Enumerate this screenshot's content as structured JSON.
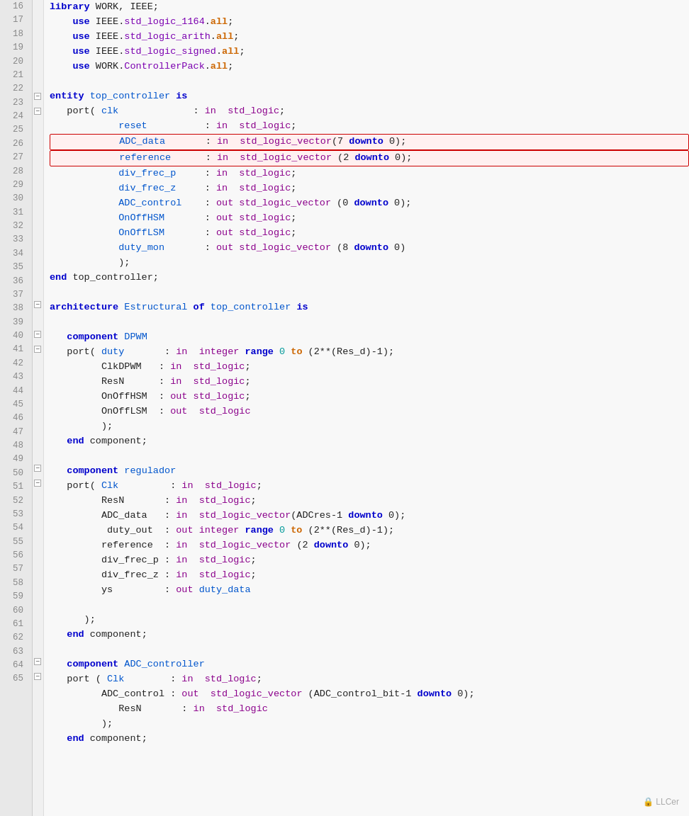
{
  "lines": [
    {
      "num": 16,
      "fold": null,
      "tokens": [
        {
          "t": "library ",
          "c": "kw-blue"
        },
        {
          "t": "WORK, IEEE;",
          "c": "normal"
        }
      ]
    },
    {
      "num": 17,
      "fold": null,
      "tokens": [
        {
          "t": "    use ",
          "c": "kw-blue"
        },
        {
          "t": "IEEE.",
          "c": "normal"
        },
        {
          "t": "std_logic_1164",
          "c": "id-violet"
        },
        {
          "t": ".",
          "c": "normal"
        },
        {
          "t": "all",
          "c": "kw-orange"
        },
        {
          "t": ";",
          "c": "normal"
        }
      ]
    },
    {
      "num": 18,
      "fold": null,
      "tokens": [
        {
          "t": "    use ",
          "c": "kw-blue"
        },
        {
          "t": "IEEE.",
          "c": "normal"
        },
        {
          "t": "std_logic_arith",
          "c": "id-violet"
        },
        {
          "t": ".",
          "c": "normal"
        },
        {
          "t": "all",
          "c": "kw-orange"
        },
        {
          "t": ";",
          "c": "normal"
        }
      ]
    },
    {
      "num": 19,
      "fold": null,
      "tokens": [
        {
          "t": "    use ",
          "c": "kw-blue"
        },
        {
          "t": "IEEE.",
          "c": "normal"
        },
        {
          "t": "std_logic_signed",
          "c": "id-violet"
        },
        {
          "t": ".",
          "c": "normal"
        },
        {
          "t": "all",
          "c": "kw-orange"
        },
        {
          "t": ";",
          "c": "normal"
        }
      ]
    },
    {
      "num": 20,
      "fold": null,
      "tokens": [
        {
          "t": "    use ",
          "c": "kw-blue"
        },
        {
          "t": "WORK.",
          "c": "normal"
        },
        {
          "t": "ControllerPack",
          "c": "id-violet"
        },
        {
          "t": ".",
          "c": "normal"
        },
        {
          "t": "all",
          "c": "kw-orange"
        },
        {
          "t": ";",
          "c": "normal"
        }
      ]
    },
    {
      "num": 21,
      "fold": null,
      "tokens": []
    },
    {
      "num": 22,
      "fold": "minus",
      "tokens": [
        {
          "t": "entity ",
          "c": "kw-blue"
        },
        {
          "t": "top_controller ",
          "c": "id-blue2"
        },
        {
          "t": "is",
          "c": "kw-blue"
        }
      ]
    },
    {
      "num": 23,
      "fold": "minus",
      "tokens": [
        {
          "t": "   port( ",
          "c": "normal"
        },
        {
          "t": "clk",
          "c": "id-blue2"
        },
        {
          "t": "             : ",
          "c": "normal"
        },
        {
          "t": "in  ",
          "c": "kw-purple"
        },
        {
          "t": "std_logic",
          "c": "kw-purple"
        },
        {
          "t": ";",
          "c": "normal"
        }
      ]
    },
    {
      "num": 24,
      "fold": null,
      "tokens": [
        {
          "t": "            ",
          "c": "normal"
        },
        {
          "t": "reset",
          "c": "id-blue2"
        },
        {
          "t": "          : ",
          "c": "normal"
        },
        {
          "t": "in  ",
          "c": "kw-purple"
        },
        {
          "t": "std_logic",
          "c": "kw-purple"
        },
        {
          "t": ";",
          "c": "normal"
        }
      ]
    },
    {
      "num": 25,
      "fold": null,
      "highlight": true,
      "tokens": [
        {
          "t": "            ",
          "c": "normal"
        },
        {
          "t": "ADC_data",
          "c": "id-blue2"
        },
        {
          "t": "       : ",
          "c": "normal"
        },
        {
          "t": "in  ",
          "c": "kw-purple"
        },
        {
          "t": "std_logic_vector",
          "c": "kw-purple"
        },
        {
          "t": "(7 ",
          "c": "normal"
        },
        {
          "t": "downto",
          "c": "kw-blue"
        },
        {
          "t": " 0);",
          "c": "normal"
        }
      ]
    },
    {
      "num": 26,
      "fold": null,
      "highlight": true,
      "tokens": [
        {
          "t": "            ",
          "c": "normal"
        },
        {
          "t": "reference",
          "c": "id-blue2"
        },
        {
          "t": "      : ",
          "c": "normal"
        },
        {
          "t": "in  ",
          "c": "kw-purple"
        },
        {
          "t": "std_logic_vector ",
          "c": "kw-purple"
        },
        {
          "t": "(2 ",
          "c": "normal"
        },
        {
          "t": "downto",
          "c": "kw-blue"
        },
        {
          "t": " 0);",
          "c": "normal"
        }
      ]
    },
    {
      "num": 27,
      "fold": null,
      "tokens": [
        {
          "t": "            ",
          "c": "normal"
        },
        {
          "t": "div_frec_p",
          "c": "id-blue2"
        },
        {
          "t": "     : ",
          "c": "normal"
        },
        {
          "t": "in  ",
          "c": "kw-purple"
        },
        {
          "t": "std_logic",
          "c": "kw-purple"
        },
        {
          "t": ";",
          "c": "normal"
        }
      ]
    },
    {
      "num": 28,
      "fold": null,
      "tokens": [
        {
          "t": "            ",
          "c": "normal"
        },
        {
          "t": "div_frec_z",
          "c": "id-blue2"
        },
        {
          "t": "     : ",
          "c": "normal"
        },
        {
          "t": "in  ",
          "c": "kw-purple"
        },
        {
          "t": "std_logic",
          "c": "kw-purple"
        },
        {
          "t": ";",
          "c": "normal"
        }
      ]
    },
    {
      "num": 29,
      "fold": null,
      "tokens": [
        {
          "t": "            ",
          "c": "normal"
        },
        {
          "t": "ADC_control",
          "c": "id-blue2"
        },
        {
          "t": "    : ",
          "c": "normal"
        },
        {
          "t": "out ",
          "c": "kw-purple"
        },
        {
          "t": "std_logic_vector ",
          "c": "kw-purple"
        },
        {
          "t": "(0 ",
          "c": "normal"
        },
        {
          "t": "downto",
          "c": "kw-blue"
        },
        {
          "t": " 0);",
          "c": "normal"
        }
      ]
    },
    {
      "num": 30,
      "fold": null,
      "tokens": [
        {
          "t": "            ",
          "c": "normal"
        },
        {
          "t": "OnOffHSM",
          "c": "id-blue2"
        },
        {
          "t": "       : ",
          "c": "normal"
        },
        {
          "t": "out ",
          "c": "kw-purple"
        },
        {
          "t": "std_logic",
          "c": "kw-purple"
        },
        {
          "t": ";",
          "c": "normal"
        }
      ]
    },
    {
      "num": 31,
      "fold": null,
      "tokens": [
        {
          "t": "            ",
          "c": "normal"
        },
        {
          "t": "OnOffLSM",
          "c": "id-blue2"
        },
        {
          "t": "       : ",
          "c": "normal"
        },
        {
          "t": "out ",
          "c": "kw-purple"
        },
        {
          "t": "std_logic",
          "c": "kw-purple"
        },
        {
          "t": ";",
          "c": "normal"
        }
      ]
    },
    {
      "num": 32,
      "fold": null,
      "tokens": [
        {
          "t": "            ",
          "c": "normal"
        },
        {
          "t": "duty_mon",
          "c": "id-blue2"
        },
        {
          "t": "       : ",
          "c": "normal"
        },
        {
          "t": "out ",
          "c": "kw-purple"
        },
        {
          "t": "std_logic_vector ",
          "c": "kw-purple"
        },
        {
          "t": "(8 ",
          "c": "normal"
        },
        {
          "t": "downto",
          "c": "kw-blue"
        },
        {
          "t": " 0)",
          "c": "normal"
        }
      ]
    },
    {
      "num": 33,
      "fold": null,
      "tokens": [
        {
          "t": "            ",
          "c": "normal"
        },
        {
          "t": ");",
          "c": "normal"
        }
      ]
    },
    {
      "num": 34,
      "fold": null,
      "tokens": [
        {
          "t": "end ",
          "c": "kw-blue"
        },
        {
          "t": "top_controller;",
          "c": "normal"
        }
      ]
    },
    {
      "num": 35,
      "fold": null,
      "tokens": []
    },
    {
      "num": 36,
      "fold": "minus",
      "tokens": [
        {
          "t": "architecture ",
          "c": "kw-blue"
        },
        {
          "t": "Estructural ",
          "c": "id-blue2"
        },
        {
          "t": "of ",
          "c": "kw-blue"
        },
        {
          "t": "top_controller ",
          "c": "id-blue2"
        },
        {
          "t": "is",
          "c": "kw-blue"
        }
      ]
    },
    {
      "num": 37,
      "fold": null,
      "tokens": []
    },
    {
      "num": 38,
      "fold": "minus",
      "tokens": [
        {
          "t": "   component ",
          "c": "kw-blue"
        },
        {
          "t": "DPWM",
          "c": "id-blue2"
        }
      ]
    },
    {
      "num": 39,
      "fold": "minus",
      "tokens": [
        {
          "t": "   port( ",
          "c": "normal"
        },
        {
          "t": "duty",
          "c": "id-blue2"
        },
        {
          "t": "       : ",
          "c": "normal"
        },
        {
          "t": "in  ",
          "c": "kw-purple"
        },
        {
          "t": "integer ",
          "c": "kw-purple"
        },
        {
          "t": "range ",
          "c": "kw-blue"
        },
        {
          "t": "0 ",
          "c": "num"
        },
        {
          "t": "to",
          "c": "kw-orange"
        },
        {
          "t": " (2**(Res_d)-1);",
          "c": "normal"
        }
      ]
    },
    {
      "num": 40,
      "fold": null,
      "tokens": [
        {
          "t": "         ClkDPWM   : ",
          "c": "normal"
        },
        {
          "t": "in  ",
          "c": "kw-purple"
        },
        {
          "t": "std_logic",
          "c": "kw-purple"
        },
        {
          "t": ";",
          "c": "normal"
        }
      ]
    },
    {
      "num": 41,
      "fold": null,
      "tokens": [
        {
          "t": "         ResN      : ",
          "c": "normal"
        },
        {
          "t": "in  ",
          "c": "kw-purple"
        },
        {
          "t": "std_logic",
          "c": "kw-purple"
        },
        {
          "t": ";",
          "c": "normal"
        }
      ]
    },
    {
      "num": 42,
      "fold": null,
      "tokens": [
        {
          "t": "         OnOffHSM  : ",
          "c": "normal"
        },
        {
          "t": "out ",
          "c": "kw-purple"
        },
        {
          "t": "std_logic",
          "c": "kw-purple"
        },
        {
          "t": ";",
          "c": "normal"
        }
      ]
    },
    {
      "num": 43,
      "fold": null,
      "tokens": [
        {
          "t": "         OnOffLSM  : ",
          "c": "normal"
        },
        {
          "t": "out  ",
          "c": "kw-purple"
        },
        {
          "t": "std_logic",
          "c": "kw-purple"
        }
      ]
    },
    {
      "num": 44,
      "fold": null,
      "tokens": [
        {
          "t": "         );",
          "c": "normal"
        }
      ]
    },
    {
      "num": 45,
      "fold": null,
      "tokens": [
        {
          "t": "   end ",
          "c": "kw-blue"
        },
        {
          "t": "component;",
          "c": "normal"
        }
      ]
    },
    {
      "num": 46,
      "fold": null,
      "tokens": []
    },
    {
      "num": 47,
      "fold": "minus",
      "tokens": [
        {
          "t": "   component ",
          "c": "kw-blue"
        },
        {
          "t": "regulador",
          "c": "id-blue2"
        }
      ]
    },
    {
      "num": 48,
      "fold": "minus",
      "tokens": [
        {
          "t": "   port( ",
          "c": "normal"
        },
        {
          "t": "Clk",
          "c": "id-blue2"
        },
        {
          "t": "         : ",
          "c": "normal"
        },
        {
          "t": "in  ",
          "c": "kw-purple"
        },
        {
          "t": "std_logic",
          "c": "kw-purple"
        },
        {
          "t": ";",
          "c": "normal"
        }
      ]
    },
    {
      "num": 49,
      "fold": null,
      "tokens": [
        {
          "t": "         ResN       : ",
          "c": "normal"
        },
        {
          "t": "in  ",
          "c": "kw-purple"
        },
        {
          "t": "std_logic",
          "c": "kw-purple"
        },
        {
          "t": ";",
          "c": "normal"
        }
      ]
    },
    {
      "num": 50,
      "fold": null,
      "tokens": [
        {
          "t": "         ADC_data   : ",
          "c": "normal"
        },
        {
          "t": "in  ",
          "c": "kw-purple"
        },
        {
          "t": "std_logic_vector",
          "c": "kw-purple"
        },
        {
          "t": "(ADCres-1 ",
          "c": "normal"
        },
        {
          "t": "downto",
          "c": "kw-blue"
        },
        {
          "t": " 0);",
          "c": "normal"
        }
      ]
    },
    {
      "num": 51,
      "fold": null,
      "tokens": [
        {
          "t": "          duty_out  : ",
          "c": "normal"
        },
        {
          "t": "out ",
          "c": "kw-purple"
        },
        {
          "t": "integer ",
          "c": "kw-purple"
        },
        {
          "t": "range ",
          "c": "kw-blue"
        },
        {
          "t": "0 ",
          "c": "num"
        },
        {
          "t": "to",
          "c": "kw-orange"
        },
        {
          "t": " (2**(Res_d)-1);",
          "c": "normal"
        }
      ]
    },
    {
      "num": 52,
      "fold": null,
      "tokens": [
        {
          "t": "         reference  : ",
          "c": "normal"
        },
        {
          "t": "in  ",
          "c": "kw-purple"
        },
        {
          "t": "std_logic_vector ",
          "c": "kw-purple"
        },
        {
          "t": "(2 ",
          "c": "normal"
        },
        {
          "t": "downto",
          "c": "kw-blue"
        },
        {
          "t": " 0);",
          "c": "normal"
        }
      ]
    },
    {
      "num": 53,
      "fold": null,
      "tokens": [
        {
          "t": "         div_frec_p : ",
          "c": "normal"
        },
        {
          "t": "in  ",
          "c": "kw-purple"
        },
        {
          "t": "std_logic",
          "c": "kw-purple"
        },
        {
          "t": ";",
          "c": "normal"
        }
      ]
    },
    {
      "num": 54,
      "fold": null,
      "tokens": [
        {
          "t": "         div_frec_z : ",
          "c": "normal"
        },
        {
          "t": "in  ",
          "c": "kw-purple"
        },
        {
          "t": "std_logic",
          "c": "kw-purple"
        },
        {
          "t": ";",
          "c": "normal"
        }
      ]
    },
    {
      "num": 55,
      "fold": null,
      "tokens": [
        {
          "t": "         ys         : ",
          "c": "normal"
        },
        {
          "t": "out ",
          "c": "kw-purple"
        },
        {
          "t": "duty_data",
          "c": "id-blue2"
        }
      ]
    },
    {
      "num": 56,
      "fold": null,
      "tokens": []
    },
    {
      "num": 57,
      "fold": null,
      "tokens": [
        {
          "t": "      );",
          "c": "normal"
        }
      ]
    },
    {
      "num": 58,
      "fold": null,
      "tokens": [
        {
          "t": "   end ",
          "c": "kw-blue"
        },
        {
          "t": "component;",
          "c": "normal"
        }
      ]
    },
    {
      "num": 59,
      "fold": null,
      "tokens": []
    },
    {
      "num": 60,
      "fold": "minus",
      "tokens": [
        {
          "t": "   component ",
          "c": "kw-blue"
        },
        {
          "t": "ADC_controller",
          "c": "id-blue2"
        }
      ]
    },
    {
      "num": 61,
      "fold": "minus",
      "tokens": [
        {
          "t": "   port ( ",
          "c": "normal"
        },
        {
          "t": "Clk",
          "c": "id-blue2"
        },
        {
          "t": "        : ",
          "c": "normal"
        },
        {
          "t": "in  ",
          "c": "kw-purple"
        },
        {
          "t": "std_logic",
          "c": "kw-purple"
        },
        {
          "t": ";",
          "c": "normal"
        }
      ]
    },
    {
      "num": 62,
      "fold": null,
      "tokens": [
        {
          "t": "         ADC_control : ",
          "c": "normal"
        },
        {
          "t": "out  ",
          "c": "kw-purple"
        },
        {
          "t": "std_logic_vector ",
          "c": "kw-purple"
        },
        {
          "t": "(ADC_control_bit-1 ",
          "c": "normal"
        },
        {
          "t": "downto",
          "c": "kw-blue"
        },
        {
          "t": " 0);",
          "c": "normal"
        }
      ]
    },
    {
      "num": 63,
      "fold": null,
      "tokens": [
        {
          "t": "            ResN       : ",
          "c": "normal"
        },
        {
          "t": "in  ",
          "c": "kw-purple"
        },
        {
          "t": "std_logic",
          "c": "kw-purple"
        }
      ]
    },
    {
      "num": 64,
      "fold": null,
      "tokens": [
        {
          "t": "         );",
          "c": "normal"
        }
      ]
    },
    {
      "num": 65,
      "fold": null,
      "tokens": [
        {
          "t": "   end ",
          "c": "kw-blue"
        },
        {
          "t": "component;",
          "c": "normal"
        }
      ]
    }
  ],
  "watermark": "🔒 LLCer",
  "fold_icons": {
    "minus": "−",
    "plus": "+"
  }
}
